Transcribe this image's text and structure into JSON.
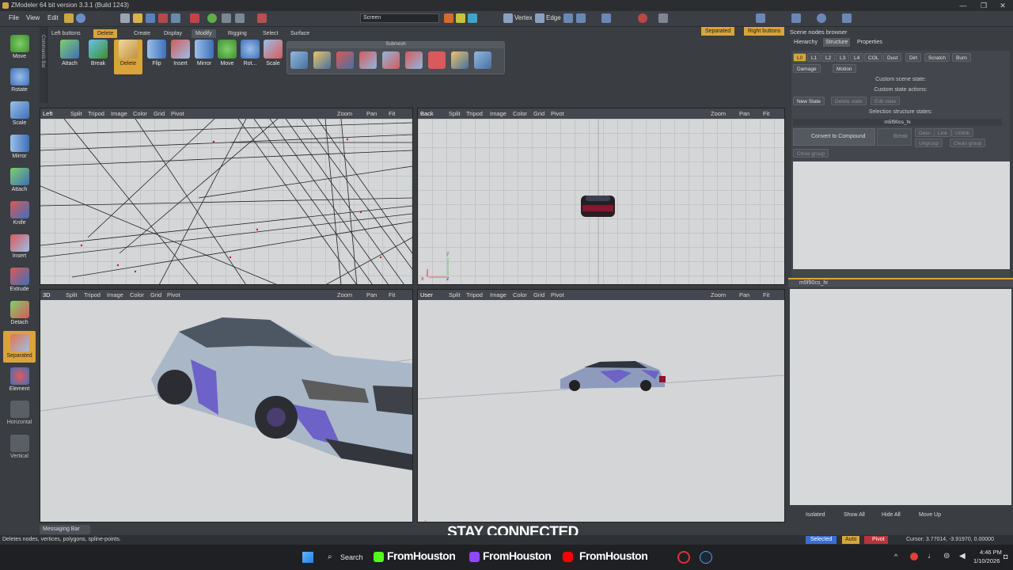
{
  "window": {
    "title": "ZModeler 64 bit version 3.3.1 (Build 1243)"
  },
  "menu": {
    "items": [
      "File",
      "View",
      "Edit"
    ]
  },
  "toolbar": {
    "screen_combo": "Screen",
    "vertex_label": "Vertex",
    "edge_label": "Edge"
  },
  "left_tools": [
    {
      "label": "Move",
      "icon": "move-arrows-icon"
    },
    {
      "label": "Rotate",
      "icon": "rotate-icon"
    },
    {
      "label": "Scale",
      "icon": "scale-icon"
    },
    {
      "label": "Mirror",
      "icon": "mirror-icon"
    },
    {
      "label": "Attach",
      "icon": "attach-icon"
    },
    {
      "label": "Knife",
      "icon": "knife-icon"
    },
    {
      "label": "Insert",
      "icon": "insert-icon"
    },
    {
      "label": "Extrude",
      "icon": "extrude-icon"
    },
    {
      "label": "Detach",
      "icon": "detach-icon"
    },
    {
      "label": "Separated",
      "icon": "separated-icon"
    },
    {
      "label": "Element",
      "icon": "element-icon"
    },
    {
      "label": "Horizontal",
      "icon": "horizontal-icon"
    },
    {
      "label": "Vertical",
      "icon": "vertical-icon"
    }
  ],
  "commands_bar": "Commands Bar",
  "ribbon": {
    "left_buttons": "Left buttons",
    "delete_tab": "Delete",
    "tabs": [
      "Create",
      "Display",
      "Modify",
      "Rigging",
      "Select",
      "Surface"
    ],
    "active_tab": "Modify",
    "separated": "Separated",
    "right_buttons": "Right buttons",
    "buttons": [
      "Attach",
      "Break",
      "Delete",
      "Flip",
      "Insert",
      "Mirror",
      "Move",
      "Rot...",
      "Scale"
    ],
    "submesh_label": "Submesh"
  },
  "viewports": [
    {
      "name": "Left",
      "menu": [
        "Split",
        "Tripod",
        "Image",
        "Color",
        "Grid",
        "Pivot"
      ]
    },
    {
      "name": "Back",
      "menu": [
        "Split",
        "Tripod",
        "Image",
        "Color",
        "Grid",
        "Pivot"
      ]
    },
    {
      "name": "3D",
      "menu": [
        "Split",
        "Tripod",
        "Image",
        "Color",
        "Grid",
        "Pivot"
      ]
    },
    {
      "name": "User",
      "menu": [
        "Split",
        "Tripod",
        "Image",
        "Color",
        "Grid",
        "Pivot"
      ]
    }
  ],
  "vp_controls": {
    "zoom": "Zoom",
    "pan": "Pan",
    "fit": "Fit"
  },
  "scene_browser": {
    "title": "Scene nodes browser",
    "tabs": [
      "Hierarchy",
      "Structure",
      "Properties"
    ],
    "active_tab": "Structure",
    "state_chips": [
      "L0",
      "L1",
      "L2",
      "L3",
      "L4",
      "COL",
      "Dust",
      "Dirt",
      "Scratch",
      "Burn"
    ],
    "damage": "Damage",
    "motion": "Motion",
    "custom_scene_state": "Custom scene state:",
    "custom_state_actions": "Custom state actions:",
    "new_state": "New State",
    "delete_state": "Delete state",
    "edit_state": "Edit state",
    "selection_states": "Selection structure states:",
    "node_name": "m5f90cs_hi",
    "convert_compound": "Convert to Compound",
    "break": "Break",
    "desc": "Desc",
    "link": "Link",
    "unlink": "Unlink",
    "ungroup": "Ungroup",
    "clean_group": "Clean group",
    "close_group": "Close group",
    "tree_node": "m5f90cs_hi",
    "bottom": {
      "isolated": "Isolated",
      "show_all": "Show All",
      "hide_all": "Hide All",
      "move_up": "Move Up"
    }
  },
  "messaging_bar": "Messaging Bar",
  "overlay": {
    "stay_connected": "STAY CONNECTED"
  },
  "status": {
    "hint": "Deletes nodes, vertices, polygons, spline-points.",
    "selected": "Selected",
    "auto": "Auto",
    "pivot": "Pivot",
    "cursor": "Cursor: 3.77014, -3.91970, 0.00000"
  },
  "taskbar": {
    "search": "Search",
    "socials": [
      {
        "name": "FromHouston",
        "icon": "kick-icon",
        "color": "#53fc18"
      },
      {
        "name": "FromHouston",
        "icon": "twitch-icon",
        "color": "#9146ff"
      },
      {
        "name": "FromHouston",
        "icon": "youtube-icon",
        "color": "#ff0000"
      }
    ],
    "time": "4:46 PM",
    "date": "1/10/2026"
  }
}
